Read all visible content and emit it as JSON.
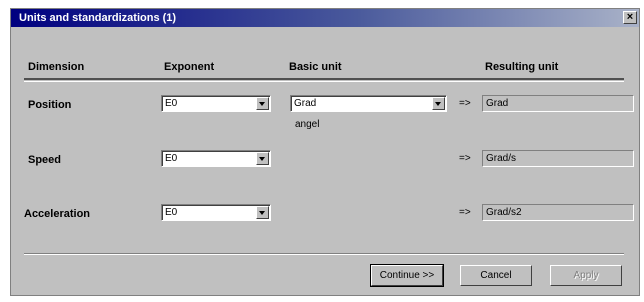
{
  "window": {
    "title": "Units and standardizations (1)",
    "close_glyph": "×"
  },
  "columns": {
    "dimension": "Dimension",
    "exponent": "Exponent",
    "basic_unit": "Basic unit",
    "resulting_unit": "Resulting unit"
  },
  "rows": [
    {
      "label": "Position",
      "exponent": "E0",
      "basic_unit": "Grad",
      "basic_unit_note": "angel",
      "arrow": "=>",
      "result": "Grad"
    },
    {
      "label": "Speed",
      "exponent": "E0",
      "arrow": "=>",
      "result": "Grad/s"
    },
    {
      "label": "Acceleration",
      "exponent": "E0",
      "arrow": "=>",
      "result": "Grad/s2"
    }
  ],
  "buttons": {
    "continue": "Continue >>",
    "cancel": "Cancel",
    "apply": "Apply"
  }
}
